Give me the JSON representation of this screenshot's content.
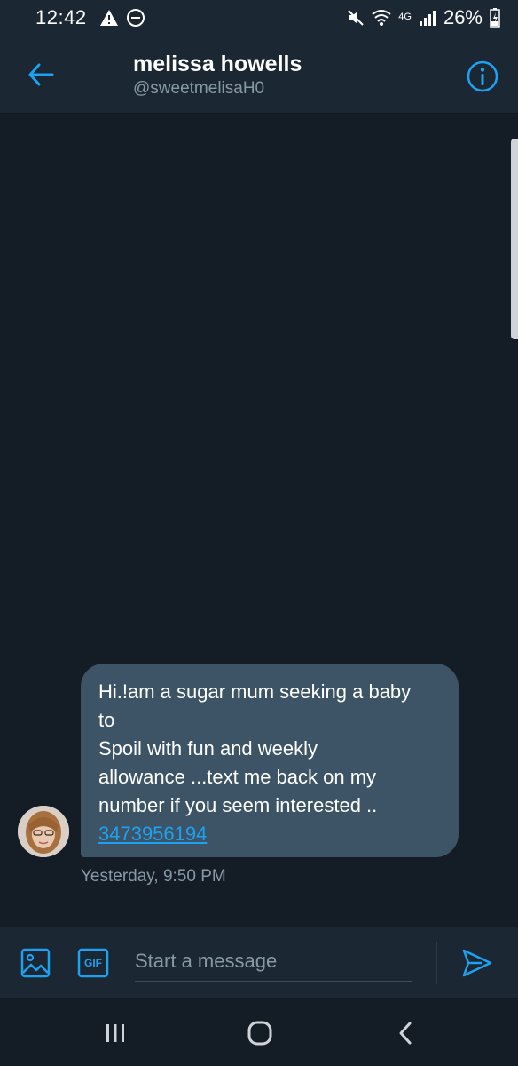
{
  "status_bar": {
    "time": "12:42",
    "network": "4G",
    "battery": "26%",
    "icons": [
      "alert-icon",
      "do-not-disturb-icon",
      "mute-icon",
      "wifi-icon",
      "signal-icon",
      "battery-icon"
    ]
  },
  "header": {
    "name": "melissa howells",
    "handle": "@sweetmelisaH0",
    "icons": [
      "back-arrow-icon",
      "info-icon"
    ]
  },
  "message": {
    "text": "Hi.!am a sugar mum seeking a baby\nto\nSpoil with fun and weekly\nallowance ...text me back on my\nnumber if you seem interested ..",
    "link": "3473956194",
    "timestamp": "Yesterday, 9:50 PM"
  },
  "composer": {
    "placeholder": "Start a message",
    "gif_label": "GIF",
    "icons": [
      "image-icon",
      "gif-icon",
      "send-icon"
    ]
  },
  "nav_bar": {
    "icons": [
      "recent-apps-icon",
      "home-icon",
      "back-icon"
    ]
  },
  "colors": {
    "background": "#141d26",
    "header": "#1b2733",
    "bubble": "#3d5466",
    "accent": "#1da1f2",
    "muted_text": "#8899a6"
  }
}
